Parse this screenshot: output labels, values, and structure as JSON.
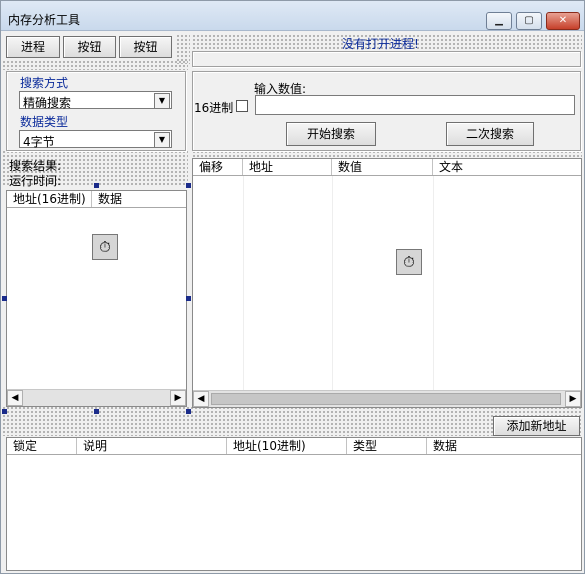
{
  "window": {
    "title": "内存分析工具",
    "minimize_icon": "minimize-icon",
    "maximize_icon": "maximize-icon",
    "close_icon": "close-icon"
  },
  "toolbar": {
    "process_label": "进程",
    "button1_label": "按钮",
    "button2_label": "按钮"
  },
  "status": {
    "message": "没有打开进程!"
  },
  "search": {
    "mode_label": "搜索方式",
    "mode_value": "精确搜索",
    "type_label": "数据类型",
    "type_value": "4字节",
    "hex_label": "16进制",
    "input_label": "输入数值:",
    "input_value": "",
    "start_label": "开始搜索",
    "second_label": "二次搜索"
  },
  "results": {
    "result_label": "搜索结果:",
    "time_label": "运行时间:",
    "columns": [
      "地址(16进制)",
      "数据"
    ]
  },
  "memory_view": {
    "columns": [
      "偏移",
      "地址",
      "数值",
      "文本"
    ]
  },
  "saved": {
    "add_label": "添加新地址",
    "columns": [
      "锁定",
      "说明",
      "地址(10进制)",
      "类型",
      "数据"
    ]
  },
  "icons": {
    "timer": "stopwatch-icon"
  }
}
